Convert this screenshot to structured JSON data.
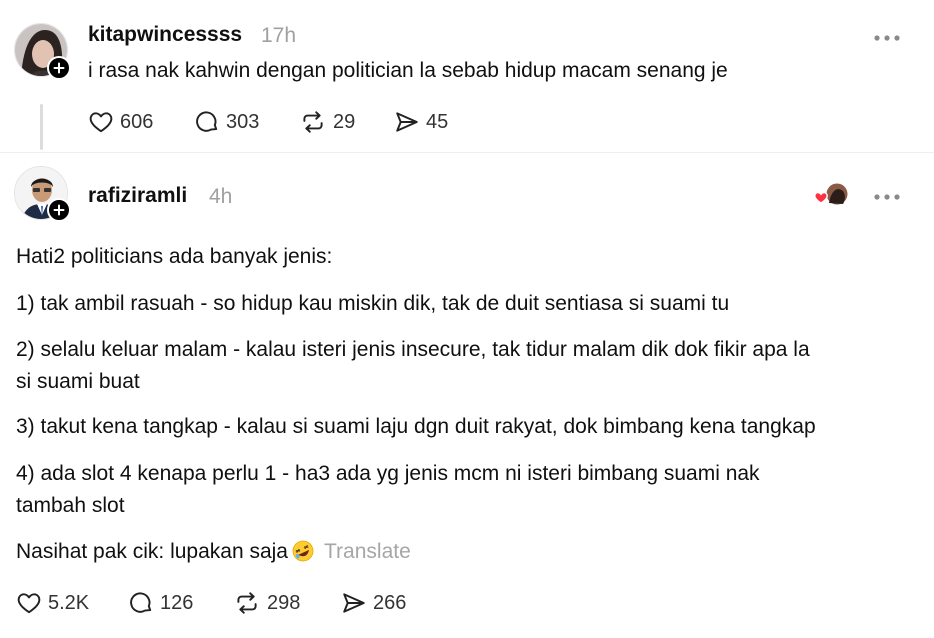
{
  "posts": [
    {
      "username": "kitapwincessss",
      "time": "17h",
      "text": "i rasa nak kahwin dengan politician la sebab hidup macam senang je",
      "actions": {
        "likes": "606",
        "replies": "303",
        "reposts": "29",
        "shares": "45"
      }
    },
    {
      "username": "rafiziramli",
      "time": "4h",
      "paragraphs": [
        "Hati2 politicians ada banyak jenis:",
        "1) tak ambil rasuah - so hidup kau miskin dik, tak de duit sentiasa si suami tu",
        "2) selalu keluar malam - kalau isteri jenis insecure, tak tidur malam dik dok fikir apa la",
        "si suami buat",
        "3) takut kena tangkap - kalau si suami laju dgn duit rakyat, dok bimbang kena tangkap",
        "4) ada slot 4 kenapa perlu 1 - ha3 ada yg jenis mcm ni isteri bimbang suami nak",
        "tambah slot",
        "Nasihat pak cik: lupakan saja"
      ],
      "emoji": "rolling-on-floor-laughing-emoji",
      "translate_label": "Translate",
      "actions": {
        "likes": "5.2K",
        "replies": "126",
        "reposts": "298",
        "shares": "266"
      }
    }
  ],
  "icons": {
    "like": "heart-icon",
    "reply": "comment-icon",
    "repost": "repost-icon",
    "share": "send-icon",
    "more": "more-icon",
    "follow": "plus-icon"
  },
  "colors": {
    "text": "#101010",
    "muted": "#a0a0a0",
    "heart_badge": "#ff3040"
  }
}
